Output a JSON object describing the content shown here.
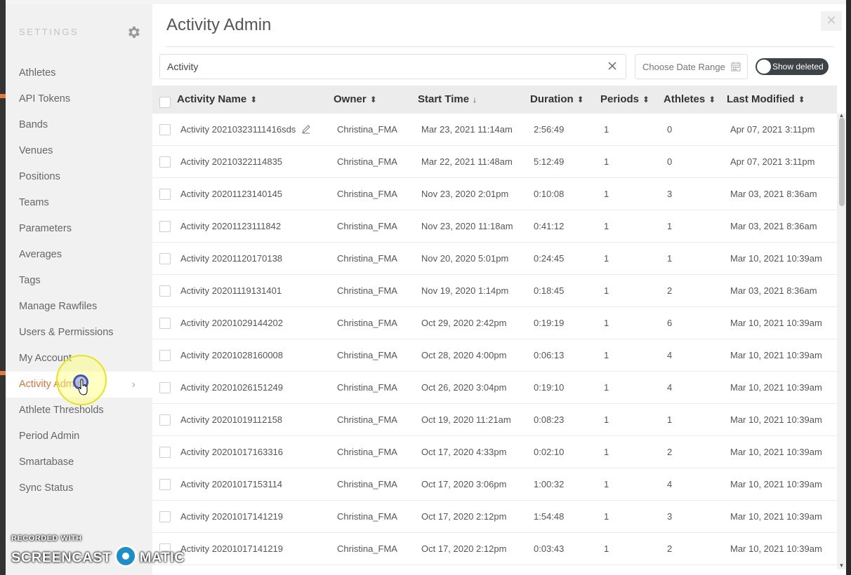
{
  "sidebar": {
    "title": "SETTINGS",
    "items": [
      {
        "label": "Athletes"
      },
      {
        "label": "API Tokens"
      },
      {
        "label": "Bands"
      },
      {
        "label": "Venues"
      },
      {
        "label": "Positions"
      },
      {
        "label": "Teams"
      },
      {
        "label": "Parameters"
      },
      {
        "label": "Averages"
      },
      {
        "label": "Tags"
      },
      {
        "label": "Manage Rawfiles"
      },
      {
        "label": "Users & Permissions"
      },
      {
        "label": "My Account"
      },
      {
        "label": "Activity Admin",
        "active": true
      },
      {
        "label": "Athlete Thresholds"
      },
      {
        "label": "Period Admin"
      },
      {
        "label": "Smartabase"
      },
      {
        "label": "Sync Status"
      }
    ]
  },
  "main": {
    "title": "Activity Admin",
    "search": {
      "value": "Activity"
    },
    "date_range": {
      "placeholder": "Choose Date Range"
    },
    "show_deleted_label": "Show deleted"
  },
  "table": {
    "columns": [
      "Activity Name",
      "Owner",
      "Start Time",
      "Duration",
      "Periods",
      "Athletes",
      "Last Modified"
    ],
    "rows": [
      [
        "Activity 20210323111416sds",
        "Christina_FMA",
        "Mar 23, 2021 11:14am",
        "2:56:49",
        "1",
        "0",
        "Apr 07, 2021 3:11pm"
      ],
      [
        "Activity 20210322114835",
        "Christina_FMA",
        "Mar 22, 2021 11:48am",
        "5:12:49",
        "1",
        "0",
        "Apr 07, 2021 3:11pm"
      ],
      [
        "Activity 20201123140145",
        "Christina_FMA",
        "Nov 23, 2020 2:01pm",
        "0:10:08",
        "1",
        "3",
        "Mar 03, 2021 8:36am"
      ],
      [
        "Activity 20201123111842",
        "Christina_FMA",
        "Nov 23, 2020 11:18am",
        "0:41:12",
        "1",
        "1",
        "Mar 03, 2021 8:36am"
      ],
      [
        "Activity 20201120170138",
        "Christina_FMA",
        "Nov 20, 2020 5:01pm",
        "0:24:45",
        "1",
        "1",
        "Mar 10, 2021 10:39am"
      ],
      [
        "Activity 20201119131401",
        "Christina_FMA",
        "Nov 19, 2020 1:14pm",
        "0:18:45",
        "1",
        "2",
        "Mar 03, 2021 8:36am"
      ],
      [
        "Activity 20201029144202",
        "Christina_FMA",
        "Oct 29, 2020 2:42pm",
        "0:19:19",
        "1",
        "6",
        "Mar 10, 2021 10:39am"
      ],
      [
        "Activity 20201028160008",
        "Christina_FMA",
        "Oct 28, 2020 4:00pm",
        "0:06:13",
        "1",
        "4",
        "Mar 10, 2021 10:39am"
      ],
      [
        "Activity 20201026151249",
        "Christina_FMA",
        "Oct 26, 2020 3:04pm",
        "0:19:10",
        "1",
        "4",
        "Mar 10, 2021 10:39am"
      ],
      [
        "Activity 20201019112158",
        "Christina_FMA",
        "Oct 19, 2020 11:21am",
        "0:08:23",
        "1",
        "1",
        "Mar 10, 2021 10:39am"
      ],
      [
        "Activity 20201017163316",
        "Christina_FMA",
        "Oct 17, 2020 4:33pm",
        "0:02:10",
        "1",
        "2",
        "Mar 10, 2021 10:39am"
      ],
      [
        "Activity 20201017153114",
        "Christina_FMA",
        "Oct 17, 2020 3:06pm",
        "1:00:32",
        "1",
        "4",
        "Mar 10, 2021 10:39am"
      ],
      [
        "Activity 20201017141219",
        "Christina_FMA",
        "Oct 17, 2020 2:12pm",
        "1:54:48",
        "1",
        "3",
        "Mar 10, 2021 10:39am"
      ],
      [
        "Activity 20201017141219",
        "Christina_FMA",
        "Oct 17, 2020 2:12pm",
        "0:03:43",
        "1",
        "2",
        "Mar 10, 2021 10:39am"
      ]
    ]
  },
  "watermark": {
    "line1": "RECORDED WITH",
    "line2a": "SCREENCAST",
    "line2b": "MATIC"
  },
  "colors": {
    "accent": "#e2733b",
    "toggle_bg": "#3e4347",
    "header_bg": "#ececec"
  }
}
